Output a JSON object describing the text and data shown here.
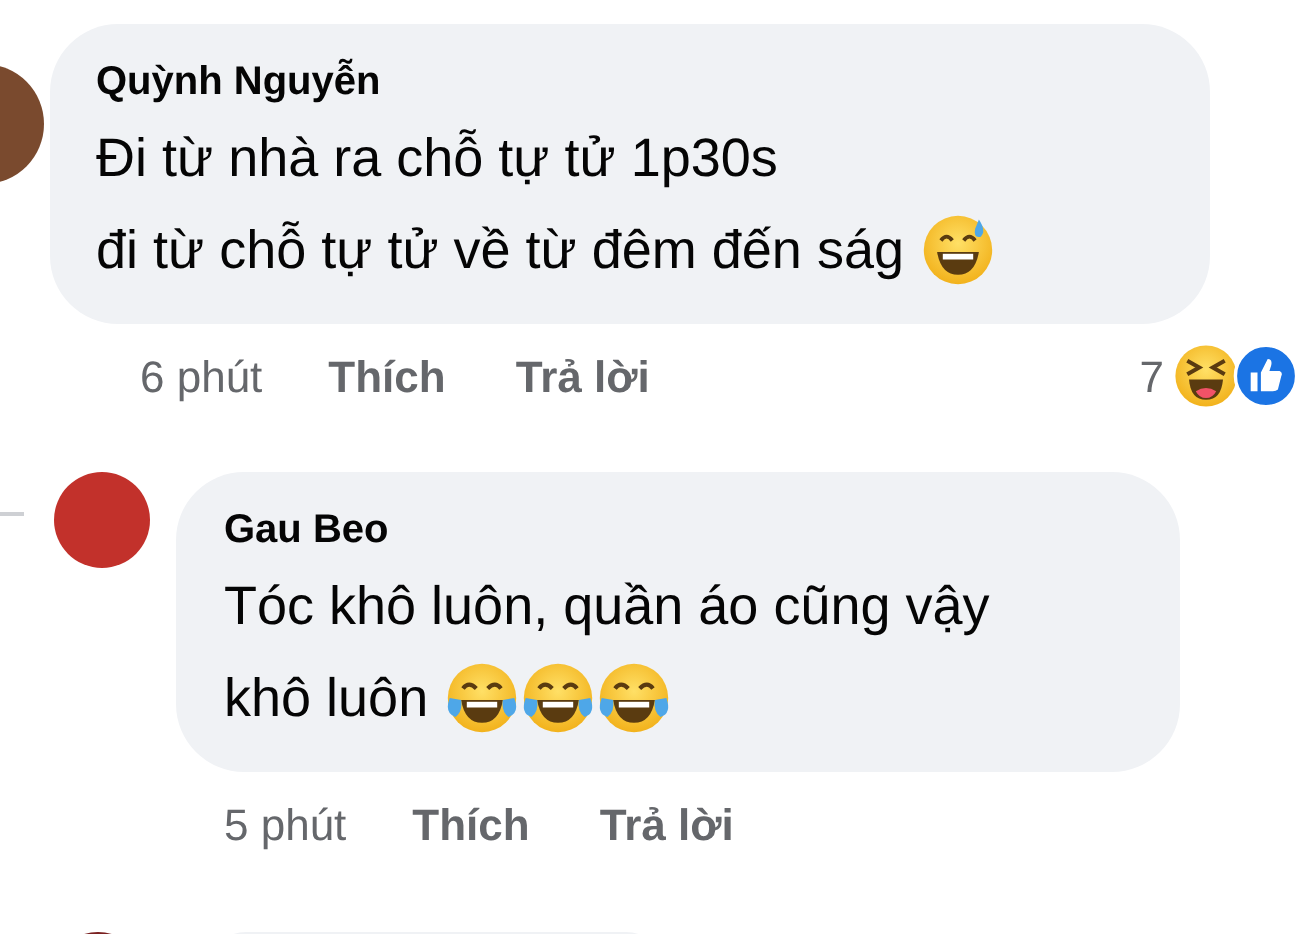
{
  "comments": [
    {
      "author": "Quỳnh Nguyễn",
      "lines": [
        {
          "text": "Đi từ nhà ra chỗ tự tử 1p30s"
        },
        {
          "text": "đi từ chỗ tự tử về từ đêm đến ság",
          "emojis": [
            {
              "kind": "sweat_smile"
            }
          ]
        }
      ],
      "time": "6 phút",
      "actions": [
        "Thích",
        "Trả lời"
      ],
      "reaction_count": "7",
      "reactions": [
        {
          "kind": "laugh"
        },
        {
          "kind": "like"
        }
      ]
    },
    {
      "author": "Gau Beo",
      "lines": [
        {
          "text": "Tóc khô luôn, quần áo cũng vậy"
        },
        {
          "text": "khô luôn",
          "emojis": [
            {
              "kind": "tears_of_joy"
            },
            {
              "kind": "tears_of_joy"
            },
            {
              "kind": "tears_of_joy"
            }
          ]
        }
      ],
      "time": "5 phút",
      "actions": [
        "Thích",
        "Trả lời"
      ]
    }
  ]
}
